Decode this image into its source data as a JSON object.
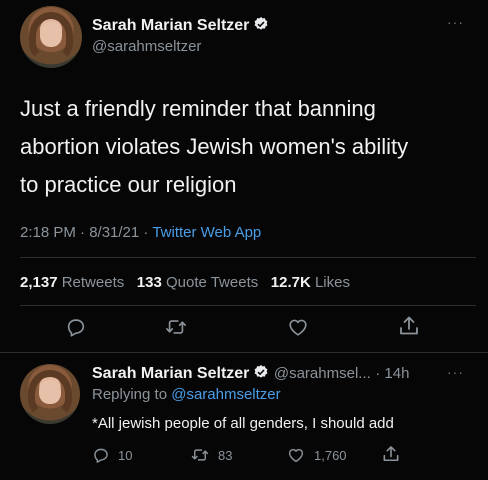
{
  "tweet": {
    "author_name": "Sarah Marian Seltzer",
    "author_handle": "@sarahmseltzer",
    "more": "···",
    "text_line1": "Just a friendly reminder that banning",
    "text_line2": "abortion violates Jewish women's ability",
    "text_line3": "to practice our religion",
    "time": "2:18 PM · 8/31/21 · ",
    "source": "Twitter Web App",
    "retweets_count": "2,137",
    "retweets_label": "Retweets",
    "quotes_count": "133",
    "quotes_label": "Quote Tweets",
    "likes_count": "12.7K",
    "likes_label": "Likes"
  },
  "reply": {
    "author_name": "Sarah Marian Seltzer",
    "author_handle": "@sarahmsel...",
    "time": "· 14h",
    "more": "···",
    "replying_label": "Replying to ",
    "replying_handle": "@sarahmseltzer",
    "text": "*All jewish people of all genders, I should add",
    "reply_count": "10",
    "retweet_count": "83",
    "like_count": "1,760"
  },
  "colors": {
    "background": "#060606",
    "link": "#4a9ee8",
    "muted": "#8b939b",
    "verified": "#e8eaed"
  },
  "icons": [
    "verified-badge-icon",
    "reply-icon",
    "retweet-icon",
    "like-icon",
    "share-icon",
    "more-icon"
  ]
}
